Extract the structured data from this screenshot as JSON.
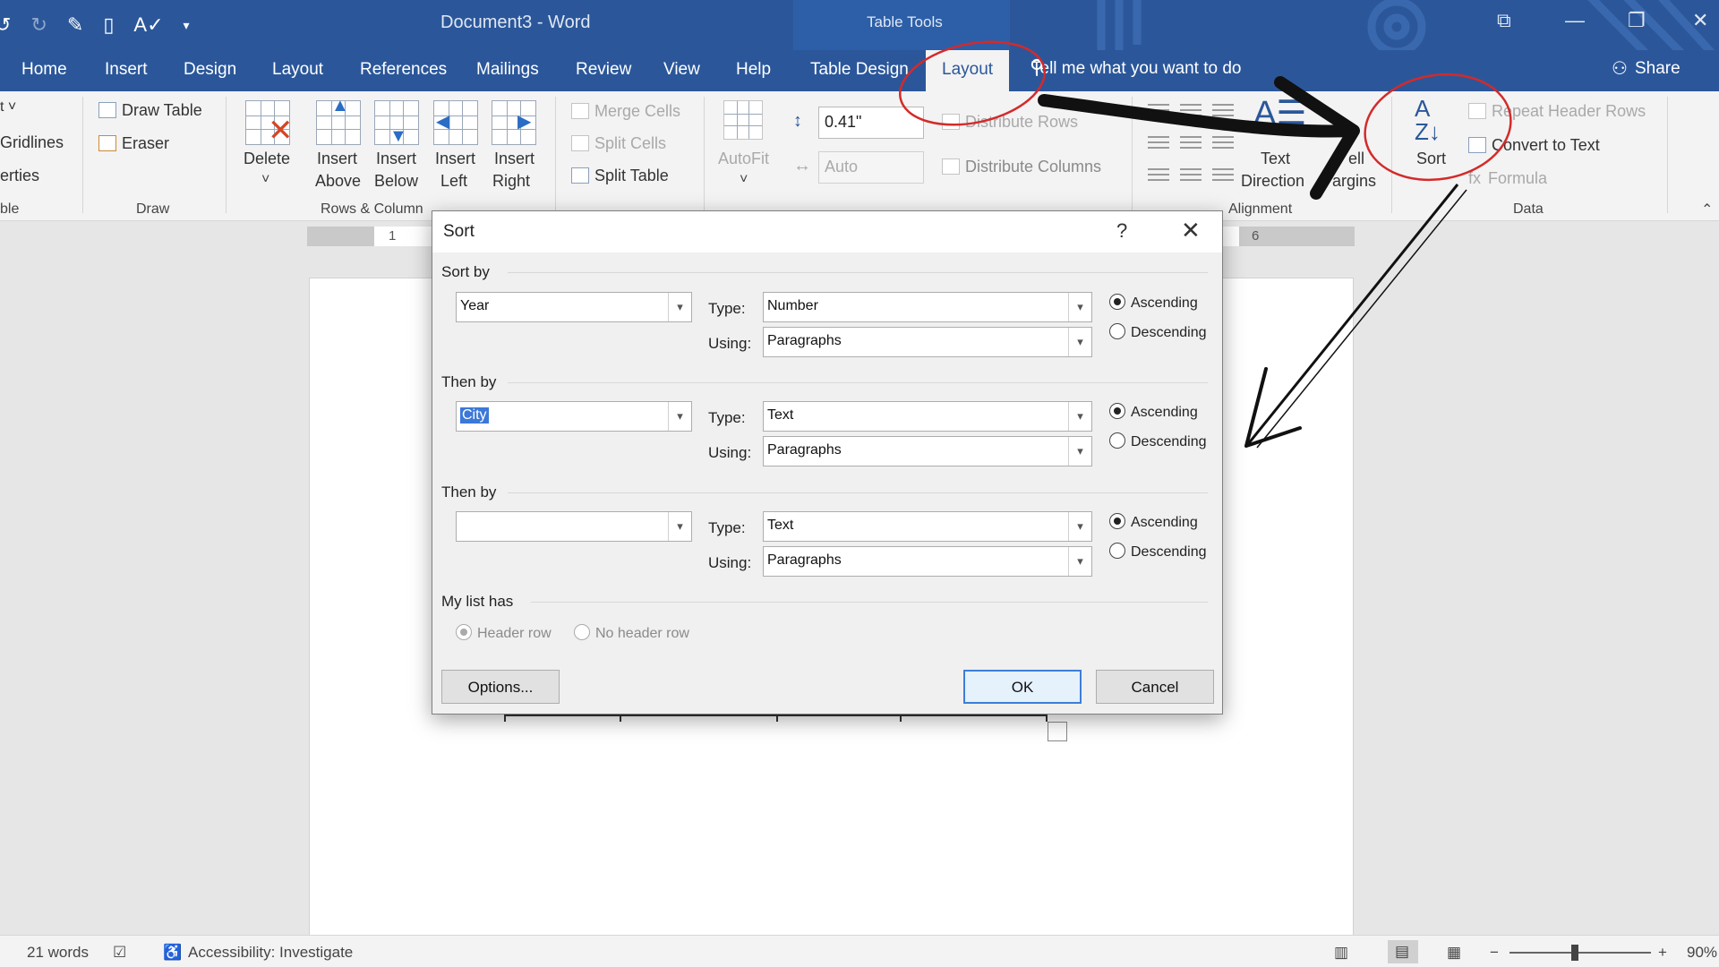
{
  "window": {
    "title": "Document3  -  Word",
    "table_tools": "Table Tools"
  },
  "tabs": [
    "Home",
    "Insert",
    "Design",
    "Layout",
    "References",
    "Mailings",
    "Review",
    "View",
    "Help",
    "Table Design",
    "Layout"
  ],
  "tell_me": "Tell me what you want to do",
  "share": "Share",
  "ribbon": {
    "table_group_partial": [
      "Gridlines",
      "erties",
      "ble"
    ],
    "draw": {
      "draw_table": "Draw Table",
      "eraser": "Eraser",
      "label": "Draw"
    },
    "rows_cols": {
      "delete": "Delete",
      "insert_above_1": "Insert",
      "insert_above_2": "Above",
      "insert_below_1": "Insert",
      "insert_below_2": "Below",
      "insert_left_1": "Insert",
      "insert_left_2": "Left",
      "insert_right_1": "Insert",
      "insert_right_2": "Right",
      "label": "Rows & Column"
    },
    "merge": {
      "merge_cells": "Merge Cells",
      "split_cells": "Split Cells",
      "split_table": "Split Table"
    },
    "cell_size": {
      "autofit": "AutoFit",
      "height": "0.41\"",
      "width": "Auto",
      "distribute_rows": "Distribute Rows",
      "distribute_cols": "Distribute Columns"
    },
    "alignment": {
      "text_dir_1": "Text",
      "text_dir_2": "Direction",
      "margins_1": "ell",
      "margins_2": "argins",
      "label": "Alignment"
    },
    "data": {
      "sort": "Sort",
      "repeat_header": "Repeat Header Rows",
      "convert": "Convert to Text",
      "formula": "Formula",
      "label": "Data"
    }
  },
  "ruler": {
    "n1": "1",
    "n6": "6"
  },
  "dialog": {
    "title": "Sort",
    "help": "?",
    "sort_by": {
      "label": "Sort by",
      "field": "Year",
      "type": "Number",
      "using": "Paragraphs",
      "ascending": "Ascending",
      "descending": "Descending"
    },
    "then_by_1": {
      "label": "Then by",
      "field": "City",
      "type": "Text",
      "using": "Paragraphs",
      "ascending": "Ascending",
      "descending": "Descending"
    },
    "then_by_2": {
      "label": "Then by",
      "field": "",
      "type": "Text",
      "using": "Paragraphs",
      "ascending": "Ascending",
      "descending": "Descending"
    },
    "type_label": "Type:",
    "using_label": "Using:",
    "list_has": {
      "label": "My list has",
      "header_row": "Header row",
      "no_header_row": "No header row"
    },
    "options": "Options...",
    "ok": "OK",
    "cancel": "Cancel"
  },
  "status": {
    "words": "21 words",
    "accessibility": "Accessibility: Investigate",
    "zoom": "90%"
  },
  "colors": {
    "accent": "#2b579a",
    "annotation_red": "#d42a2a",
    "annotation_black": "#111111"
  }
}
